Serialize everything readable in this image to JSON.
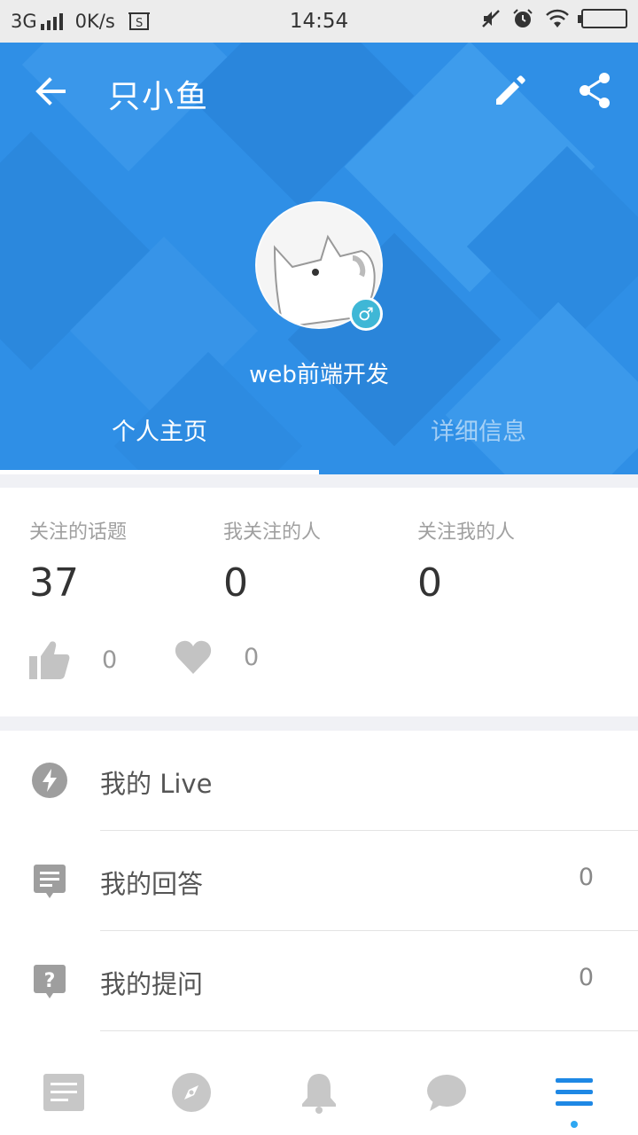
{
  "status_bar": {
    "network": "3G",
    "speed": "0K/s",
    "time": "14:54"
  },
  "header": {
    "title": "只小鱼",
    "bio": "web前端开发",
    "gender_symbol": "♂",
    "background_color": "#2f8fe6",
    "tabs": [
      {
        "label": "个人主页",
        "active": true
      },
      {
        "label": "详细信息",
        "active": false
      }
    ]
  },
  "stats": [
    {
      "label": "关注的话题",
      "value": "37"
    },
    {
      "label": "我关注的人",
      "value": "0"
    },
    {
      "label": "关注我的人",
      "value": "0"
    }
  ],
  "reactions": {
    "likes": "0",
    "favorites": "0"
  },
  "menu": [
    {
      "label": "我的 Live",
      "count": "",
      "icon": "lightning-icon"
    },
    {
      "label": "我的回答",
      "count": "0",
      "icon": "answer-icon"
    },
    {
      "label": "我的提问",
      "count": "0",
      "icon": "question-icon"
    }
  ],
  "bottom_nav": [
    {
      "icon": "feed-icon"
    },
    {
      "icon": "explore-icon"
    },
    {
      "icon": "bell-icon"
    },
    {
      "icon": "chat-icon"
    },
    {
      "icon": "menu-icon",
      "active": true
    }
  ],
  "colors": {
    "accent": "#1e88e5",
    "icon_gray": "#c7c7c7"
  }
}
